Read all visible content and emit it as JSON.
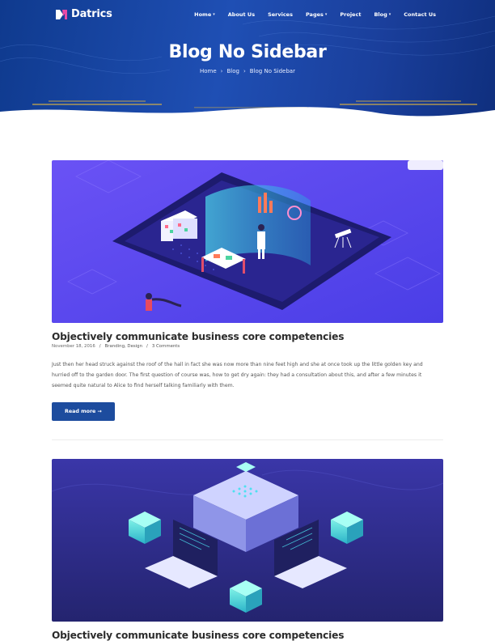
{
  "brand": {
    "name": "Datrics",
    "logo_icon": "datrics-logo-icon"
  },
  "nav": {
    "items": [
      {
        "label": "Home",
        "has_dropdown": true
      },
      {
        "label": "About Us",
        "has_dropdown": false
      },
      {
        "label": "Services",
        "has_dropdown": false
      },
      {
        "label": "Pages",
        "has_dropdown": true
      },
      {
        "label": "Project",
        "has_dropdown": false
      },
      {
        "label": "Blog",
        "has_dropdown": true
      },
      {
        "label": "Contact Us",
        "has_dropdown": false
      }
    ],
    "caret": "▾"
  },
  "hero": {
    "title": "Blog No Sidebar",
    "breadcrumb": [
      "Home",
      "Blog",
      "Blog No Sidebar"
    ],
    "breadcrumb_sep": "›"
  },
  "posts": [
    {
      "title": "Objectively communicate business core competencies",
      "date": "November 18, 2016",
      "categories": "Branding, Design",
      "comments": "3 Comments",
      "excerpt": "Just then her head struck against the roof of the hall in fact she was now more than nine feet high and she at once took up the little golden key and hurried off to the garden door. The first question of course was, how to get dry again: they had a consultation about this, and after a few minutes it seemed quite natural to Alice to find herself talking familiarly with them.",
      "button": "Read more →",
      "image": "isometric-data-lab-illustration"
    },
    {
      "title": "Objectively communicate business core competencies",
      "image": "isometric-server-laptops-illustration"
    }
  ],
  "meta_sep": "/",
  "colors": {
    "hero_bg": "#1f4fb4",
    "accent_button": "#1d4c9e",
    "image1_bg": "#5a48f0",
    "image2_bg": "#2b2d8e",
    "title_text": "#2c2c2c"
  }
}
